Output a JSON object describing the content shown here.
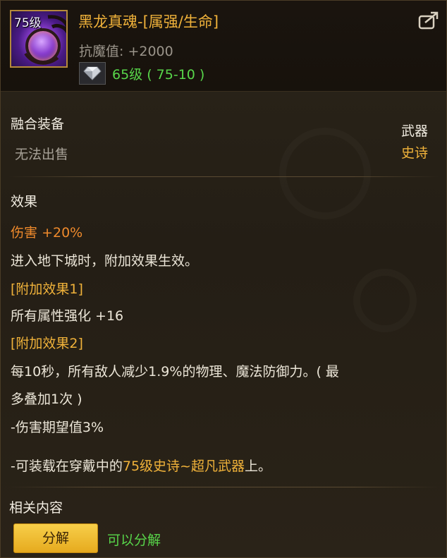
{
  "item": {
    "level_badge": "75级",
    "name": "黑龙真魂-[属强/生命]",
    "stat": "抗魔值: +2000",
    "level_req": "65级 ( 75-10 )"
  },
  "info": {
    "category": "融合装备",
    "sell_status": "无法出售",
    "slot": "武器",
    "rarity": "史诗"
  },
  "effects": {
    "title": "效果",
    "damage_label": "伤害",
    "damage_value": "+20%",
    "dungeon_note": "进入地下城时，附加效果生效。",
    "bonus1_title": "[附加效果1]",
    "bonus1_text": "所有属性强化 +16",
    "bonus2_title": "[附加效果2]",
    "bonus2_line1": "每10秒，所有敌人减少1.9%的物理、魔法防御力。( 最",
    "bonus2_line2": "多叠加1次 )",
    "expected": "-伤害期望值3%",
    "equip_prefix": "-可装载在穿戴中的",
    "equip_highlight": "75级史诗~超凡武器",
    "equip_suffix": "上。"
  },
  "related": {
    "title": "相关内容",
    "button_label": "分解",
    "status": "可以分解"
  },
  "colors": {
    "name": "#f0b23a",
    "green": "#58d64a",
    "orange": "#ef8a2c",
    "gold": "#f0b23a",
    "button": "#f2c038"
  },
  "icons": {
    "export": "export-icon",
    "gem": "gem-icon",
    "item": "item-icon"
  }
}
